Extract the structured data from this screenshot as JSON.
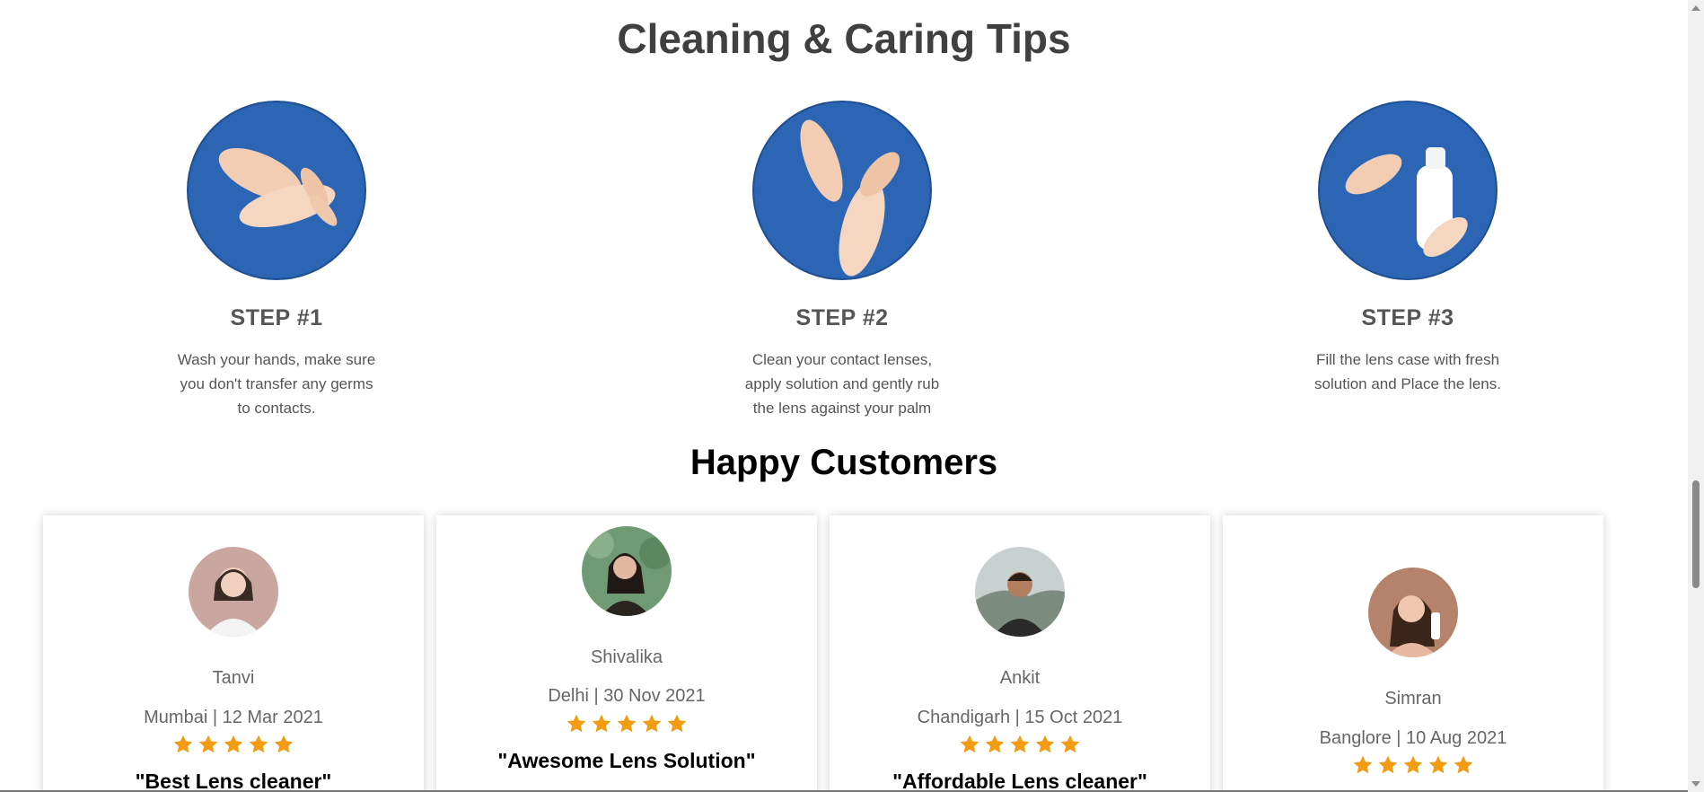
{
  "tips": {
    "title": "Cleaning & Caring Tips",
    "steps": [
      {
        "title": "STEP #1",
        "desc": "Wash your hands, make sure you don't transfer any germs to contacts.",
        "image": "washing-hands-image"
      },
      {
        "title": "STEP #2",
        "desc": "Clean your contact lenses, apply solution and gently rub the lens against your palm",
        "image": "rubbing-lens-image"
      },
      {
        "title": "STEP #3",
        "desc": "Fill the lens case with fresh solution and Place the lens.",
        "image": "solution-bottle-image"
      }
    ]
  },
  "customers": {
    "title": "Happy Customers",
    "star_color": "#f39c12",
    "cards": [
      {
        "name": "Tanvi",
        "meta": "Mumbai | 12 Mar 2021",
        "rating": 5,
        "quote": "\"Best Lens cleaner\""
      },
      {
        "name": "Shivalika",
        "meta": "Delhi | 30 Nov 2021",
        "rating": 5,
        "quote": "\"Awesome Lens Solution\""
      },
      {
        "name": "Ankit",
        "meta": "Chandigarh | 15 Oct 2021",
        "rating": 5,
        "quote": "\"Affordable Lens cleaner\""
      },
      {
        "name": "Simran",
        "meta": "Banglore | 10 Aug 2021",
        "rating": 5,
        "quote": ""
      }
    ]
  },
  "colors": {
    "circle_blue": "#2b65b3",
    "heading_gray": "#404040"
  }
}
